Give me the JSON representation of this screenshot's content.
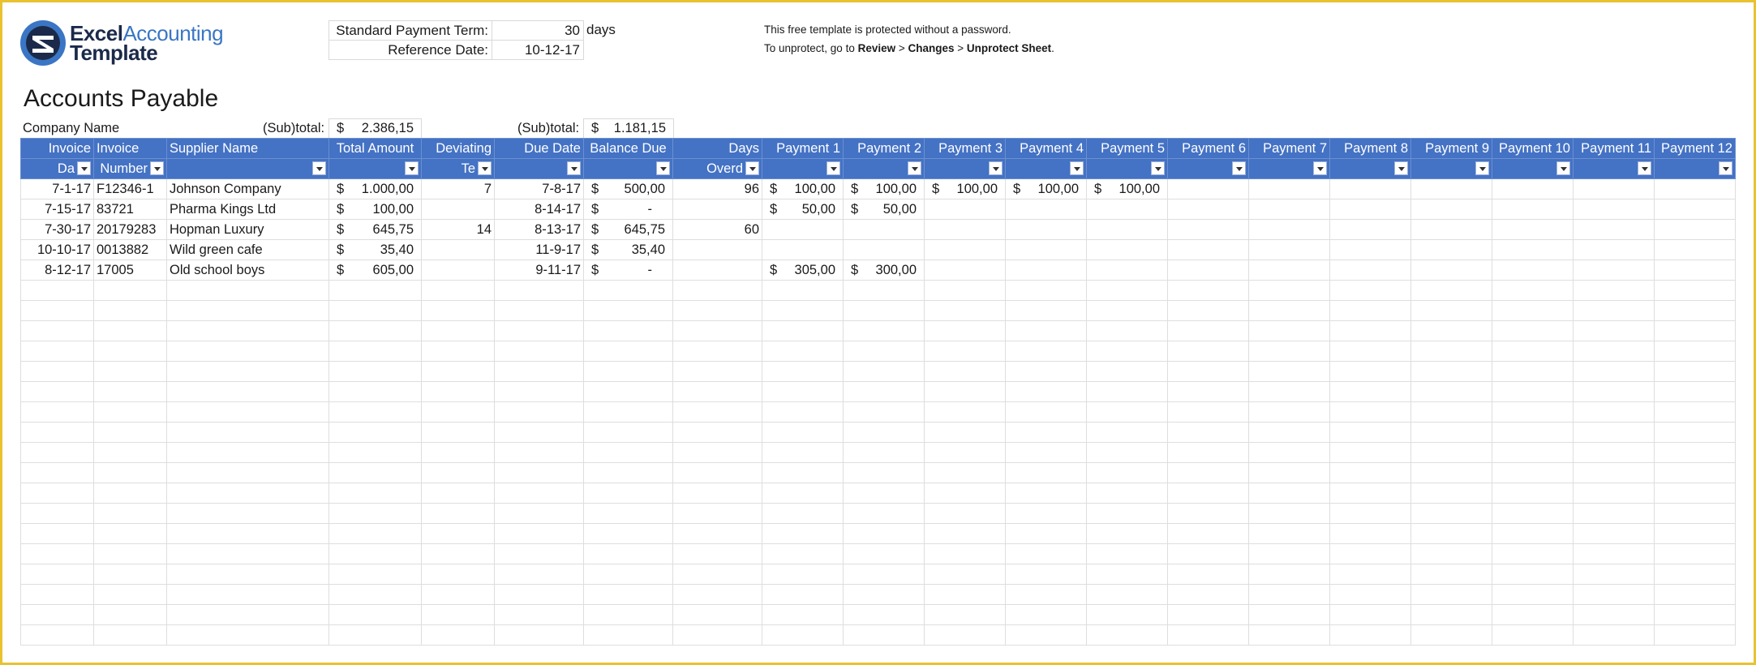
{
  "logo": {
    "part1": "Excel",
    "part2": "Accounting",
    "part3": "Template"
  },
  "params": {
    "payment_term_label": "Standard Payment Term:",
    "payment_term_value": "30",
    "payment_term_unit": "days",
    "reference_date_label": "Reference Date:",
    "reference_date_value": "10-12-17"
  },
  "notice": {
    "line1": "This free template is protected without a password.",
    "line2_prefix": "To unprotect, go to ",
    "review": "Review",
    "sep1": " > ",
    "changes": "Changes",
    "sep2": " > ",
    "unprotect": "Unprotect Sheet",
    "line2_suffix": "."
  },
  "sheet_title": "Accounts Payable",
  "totals": {
    "company_label": "Company Name",
    "subtotal_label_1": "(Sub)total:",
    "subtotal_cur_1": "$",
    "subtotal_value_1": "2.386,15",
    "subtotal_label_2": "(Sub)total:",
    "subtotal_cur_2": "$",
    "subtotal_value_2": "1.181,15"
  },
  "headers": [
    {
      "top": "Invoice",
      "bottom": "Da"
    },
    {
      "top": "Invoice",
      "bottom": "Number"
    },
    {
      "top": "Supplier Name",
      "bottom": ""
    },
    {
      "top": "Total Amount",
      "bottom": ""
    },
    {
      "top": "Deviating",
      "bottom": "Te"
    },
    {
      "top": "Due Date",
      "bottom": ""
    },
    {
      "top": "Balance Due",
      "bottom": ""
    },
    {
      "top": "Days",
      "bottom": "Overd"
    },
    {
      "top": "Payment 1",
      "bottom": ""
    },
    {
      "top": "Payment 2",
      "bottom": ""
    },
    {
      "top": "Payment 3",
      "bottom": ""
    },
    {
      "top": "Payment 4",
      "bottom": ""
    },
    {
      "top": "Payment 5",
      "bottom": ""
    },
    {
      "top": "Payment 6",
      "bottom": ""
    },
    {
      "top": "Payment 7",
      "bottom": ""
    },
    {
      "top": "Payment 8",
      "bottom": ""
    },
    {
      "top": "Payment 9",
      "bottom": ""
    },
    {
      "top": "Payment 10",
      "bottom": ""
    },
    {
      "top": "Payment 11",
      "bottom": ""
    },
    {
      "top": "Payment 12",
      "bottom": ""
    }
  ],
  "currency_symbol": "$",
  "rows": [
    {
      "invoice_date": "7-1-17",
      "invoice_number": "F12346-1",
      "supplier": "Johnson Company",
      "total": "1.000,00",
      "deviating_term": "7",
      "due_date": "7-8-17",
      "balance": "500,00",
      "days_overdue": "96",
      "payments": [
        "100,00",
        "100,00",
        "100,00",
        "100,00",
        "100,00",
        "",
        "",
        "",
        "",
        "",
        "",
        ""
      ]
    },
    {
      "invoice_date": "7-15-17",
      "invoice_number": "83721",
      "supplier": "Pharma Kings Ltd",
      "total": "100,00",
      "deviating_term": "",
      "due_date": "8-14-17",
      "balance": "-",
      "days_overdue": "",
      "payments": [
        "50,00",
        "50,00",
        "",
        "",
        "",
        "",
        "",
        "",
        "",
        "",
        "",
        ""
      ]
    },
    {
      "invoice_date": "7-30-17",
      "invoice_number": "20179283",
      "supplier": "Hopman Luxury",
      "total": "645,75",
      "deviating_term": "14",
      "due_date": "8-13-17",
      "balance": "645,75",
      "days_overdue": "60",
      "payments": [
        "",
        "",
        "",
        "",
        "",
        "",
        "",
        "",
        "",
        "",
        "",
        ""
      ]
    },
    {
      "invoice_date": "10-10-17",
      "invoice_number": "0013882",
      "supplier": "Wild green cafe",
      "total": "35,40",
      "deviating_term": "",
      "due_date": "11-9-17",
      "balance": "35,40",
      "days_overdue": "",
      "payments": [
        "",
        "",
        "",
        "",
        "",
        "",
        "",
        "",
        "",
        "",
        "",
        ""
      ]
    },
    {
      "invoice_date": "8-12-17",
      "invoice_number": "17005",
      "supplier": "Old school boys",
      "total": "605,00",
      "deviating_term": "",
      "due_date": "9-11-17",
      "balance": "-",
      "days_overdue": "",
      "payments": [
        "305,00",
        "300,00",
        "",
        "",
        "",
        "",
        "",
        "",
        "",
        "",
        "",
        ""
      ]
    }
  ],
  "empty_rows": 18,
  "colors": {
    "header_bg": "#4472c4",
    "frame": "#e8c230",
    "logo_dark": "#1b2a4a",
    "logo_blue": "#3a76c4"
  }
}
